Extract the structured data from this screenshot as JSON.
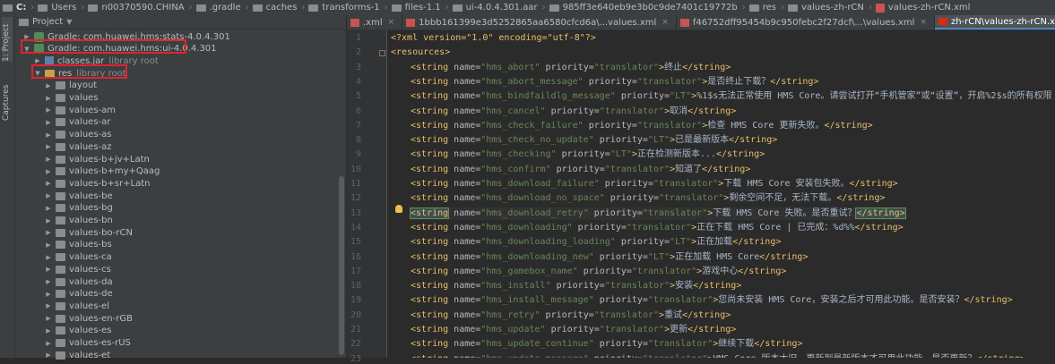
{
  "breadcrumb": {
    "items": [
      {
        "label": "C:",
        "icon": "drive-icon",
        "bold": true
      },
      {
        "label": "Users",
        "icon": "folder-icon"
      },
      {
        "label": "n00370590.CHINA",
        "icon": "folder-icon"
      },
      {
        "label": ".gradle",
        "icon": "folder-icon"
      },
      {
        "label": "caches",
        "icon": "folder-icon"
      },
      {
        "label": "transforms-1",
        "icon": "folder-icon"
      },
      {
        "label": "files-1.1",
        "icon": "folder-icon"
      },
      {
        "label": "ui-4.0.4.301.aar",
        "icon": "folder-icon"
      },
      {
        "label": "985ff3e640eb9e3b0c9de7401c19772b",
        "icon": "folder-icon"
      },
      {
        "label": "res",
        "icon": "folder-icon"
      },
      {
        "label": "values-zh-rCN",
        "icon": "folder-icon"
      },
      {
        "label": "values-zh-rCN.xml",
        "icon": "xml-file-icon"
      }
    ]
  },
  "stripe": {
    "project_label": "1: Project",
    "captures_label": "Captures"
  },
  "project": {
    "title": "Project",
    "tree": [
      {
        "label": "Gradle: com.huawei.hms:stats-4.0.4.301",
        "type": "gradle",
        "level": 0,
        "expanded": false
      },
      {
        "label": "Gradle: com.huawei.hms:ui-4.0.4.301",
        "type": "gradle",
        "level": 0,
        "expanded": true
      },
      {
        "label": "classes.jar",
        "suffix": "library root",
        "type": "jar",
        "level": 1,
        "expanded": false
      },
      {
        "label": "res",
        "suffix": "library root",
        "type": "res",
        "level": 1,
        "expanded": true
      },
      {
        "label": "layout",
        "type": "folder",
        "level": 2,
        "expanded": false
      },
      {
        "label": "values",
        "type": "folder",
        "level": 2,
        "expanded": false
      },
      {
        "label": "values-am",
        "type": "folder",
        "level": 2,
        "expanded": false
      },
      {
        "label": "values-ar",
        "type": "folder",
        "level": 2,
        "expanded": false
      },
      {
        "label": "values-as",
        "type": "folder",
        "level": 2,
        "expanded": false
      },
      {
        "label": "values-az",
        "type": "folder",
        "level": 2,
        "expanded": false
      },
      {
        "label": "values-b+jv+Latn",
        "type": "folder",
        "level": 2,
        "expanded": false
      },
      {
        "label": "values-b+my+Qaag",
        "type": "folder",
        "level": 2,
        "expanded": false
      },
      {
        "label": "values-b+sr+Latn",
        "type": "folder",
        "level": 2,
        "expanded": false
      },
      {
        "label": "values-be",
        "type": "folder",
        "level": 2,
        "expanded": false
      },
      {
        "label": "values-bg",
        "type": "folder",
        "level": 2,
        "expanded": false
      },
      {
        "label": "values-bn",
        "type": "folder",
        "level": 2,
        "expanded": false
      },
      {
        "label": "values-bo-rCN",
        "type": "folder",
        "level": 2,
        "expanded": false
      },
      {
        "label": "values-bs",
        "type": "folder",
        "level": 2,
        "expanded": false
      },
      {
        "label": "values-ca",
        "type": "folder",
        "level": 2,
        "expanded": false
      },
      {
        "label": "values-cs",
        "type": "folder",
        "level": 2,
        "expanded": false
      },
      {
        "label": "values-da",
        "type": "folder",
        "level": 2,
        "expanded": false
      },
      {
        "label": "values-de",
        "type": "folder",
        "level": 2,
        "expanded": false
      },
      {
        "label": "values-el",
        "type": "folder",
        "level": 2,
        "expanded": false
      },
      {
        "label": "values-en-rGB",
        "type": "folder",
        "level": 2,
        "expanded": false
      },
      {
        "label": "values-es",
        "type": "folder",
        "level": 2,
        "expanded": false
      },
      {
        "label": "values-es-rUS",
        "type": "folder",
        "level": 2,
        "expanded": false
      },
      {
        "label": "values-et",
        "type": "folder",
        "level": 2,
        "expanded": false
      }
    ]
  },
  "tabs": [
    {
      "label": ".xml",
      "icon": "xml-file-icon",
      "active": false
    },
    {
      "label": "1bbb161399e3d5252865aa6580cfcd6a\\...values.xml",
      "icon": "xml-file-icon",
      "active": false
    },
    {
      "label": "f46752dff95454b9c950febc2f27dcf\\...\\values.xml",
      "icon": "xml-file-icon",
      "active": false
    },
    {
      "label": "zh-rCN\\values-zh-rCN.xml",
      "icon": "china-flag-icon",
      "active": true
    },
    {
      "label": "zh-rCN\\values-zh-rCN.xml",
      "icon": "china-flag-icon",
      "active": false
    }
  ],
  "editor": {
    "lines": [
      {
        "n": "1",
        "raw": "<?xml version=\"1.0\" encoding=\"utf-8\"?>"
      },
      {
        "n": "2",
        "raw": "<resources>"
      },
      {
        "n": "3",
        "name": "hms_abort",
        "priority": "translator",
        "text": "终止"
      },
      {
        "n": "4",
        "name": "hms_abort_message",
        "priority": "translator",
        "text": "是否终止下载？"
      },
      {
        "n": "5",
        "name": "hms_bindfaildlg_message",
        "priority": "LT",
        "text": "%1$s无法正常使用 HMS Core。请尝试打开“手机管家”或“设置”，开启%2$s的所有权限（“自"
      },
      {
        "n": "6",
        "name": "hms_cancel",
        "priority": "translator",
        "text": "取消"
      },
      {
        "n": "7",
        "name": "hms_check_failure",
        "priority": "translator",
        "text": "检查 HMS Core 更新失败。"
      },
      {
        "n": "8",
        "name": "hms_check_no_update",
        "priority": "LT",
        "text": "已是最新版本"
      },
      {
        "n": "9",
        "name": "hms_checking",
        "priority": "LT",
        "text": "正在检测新版本..."
      },
      {
        "n": "10",
        "name": "hms_confirm",
        "priority": "translator",
        "text": "知道了"
      },
      {
        "n": "11",
        "name": "hms_download_failure",
        "priority": "translator",
        "text": "下载 HMS Core 安装包失败。"
      },
      {
        "n": "12",
        "name": "hms_download_no_space",
        "priority": "translator",
        "text": "剩余空间不足，无法下载。"
      },
      {
        "n": "13",
        "name": "hms_download_retry",
        "priority": "translator",
        "text": "下载 HMS Core 失败。是否重试？"
      },
      {
        "n": "14",
        "name": "hms_downloading",
        "priority": "translator",
        "text": "正在下载 HMS Core | 已完成：%d%%"
      },
      {
        "n": "15",
        "name": "hms_downloading_loading",
        "priority": "LT",
        "text": "正在加载"
      },
      {
        "n": "16",
        "name": "hms_downloading_new",
        "priority": "LT",
        "text": "正在加载 HMS Core"
      },
      {
        "n": "17",
        "name": "hms_gamebox_name",
        "priority": "translator",
        "text": "游戏中心"
      },
      {
        "n": "18",
        "name": "hms_install",
        "priority": "translator",
        "text": "安装"
      },
      {
        "n": "19",
        "name": "hms_install_message",
        "priority": "translator",
        "text": "您尚未安装 HMS Core，安装之后才可用此功能。是否安装？"
      },
      {
        "n": "20",
        "name": "hms_retry",
        "priority": "translator",
        "text": "重试"
      },
      {
        "n": "21",
        "name": "hms_update",
        "priority": "translator",
        "text": "更新"
      },
      {
        "n": "22",
        "name": "hms_update_continue",
        "priority": "translator",
        "text": "继续下载"
      },
      {
        "n": "23",
        "name": "hms_update_message",
        "priority": "translator",
        "text": "HMS Core 版本太旧，更新到最新版本才可用此功能。是否更新？"
      }
    ]
  },
  "colors": {
    "highlight_box": "#e0242e",
    "tag": "#e8bf6a",
    "attr_value": "#6a8759",
    "background": "#2b2b2b",
    "active_tab_underline": "#4a88c7"
  }
}
